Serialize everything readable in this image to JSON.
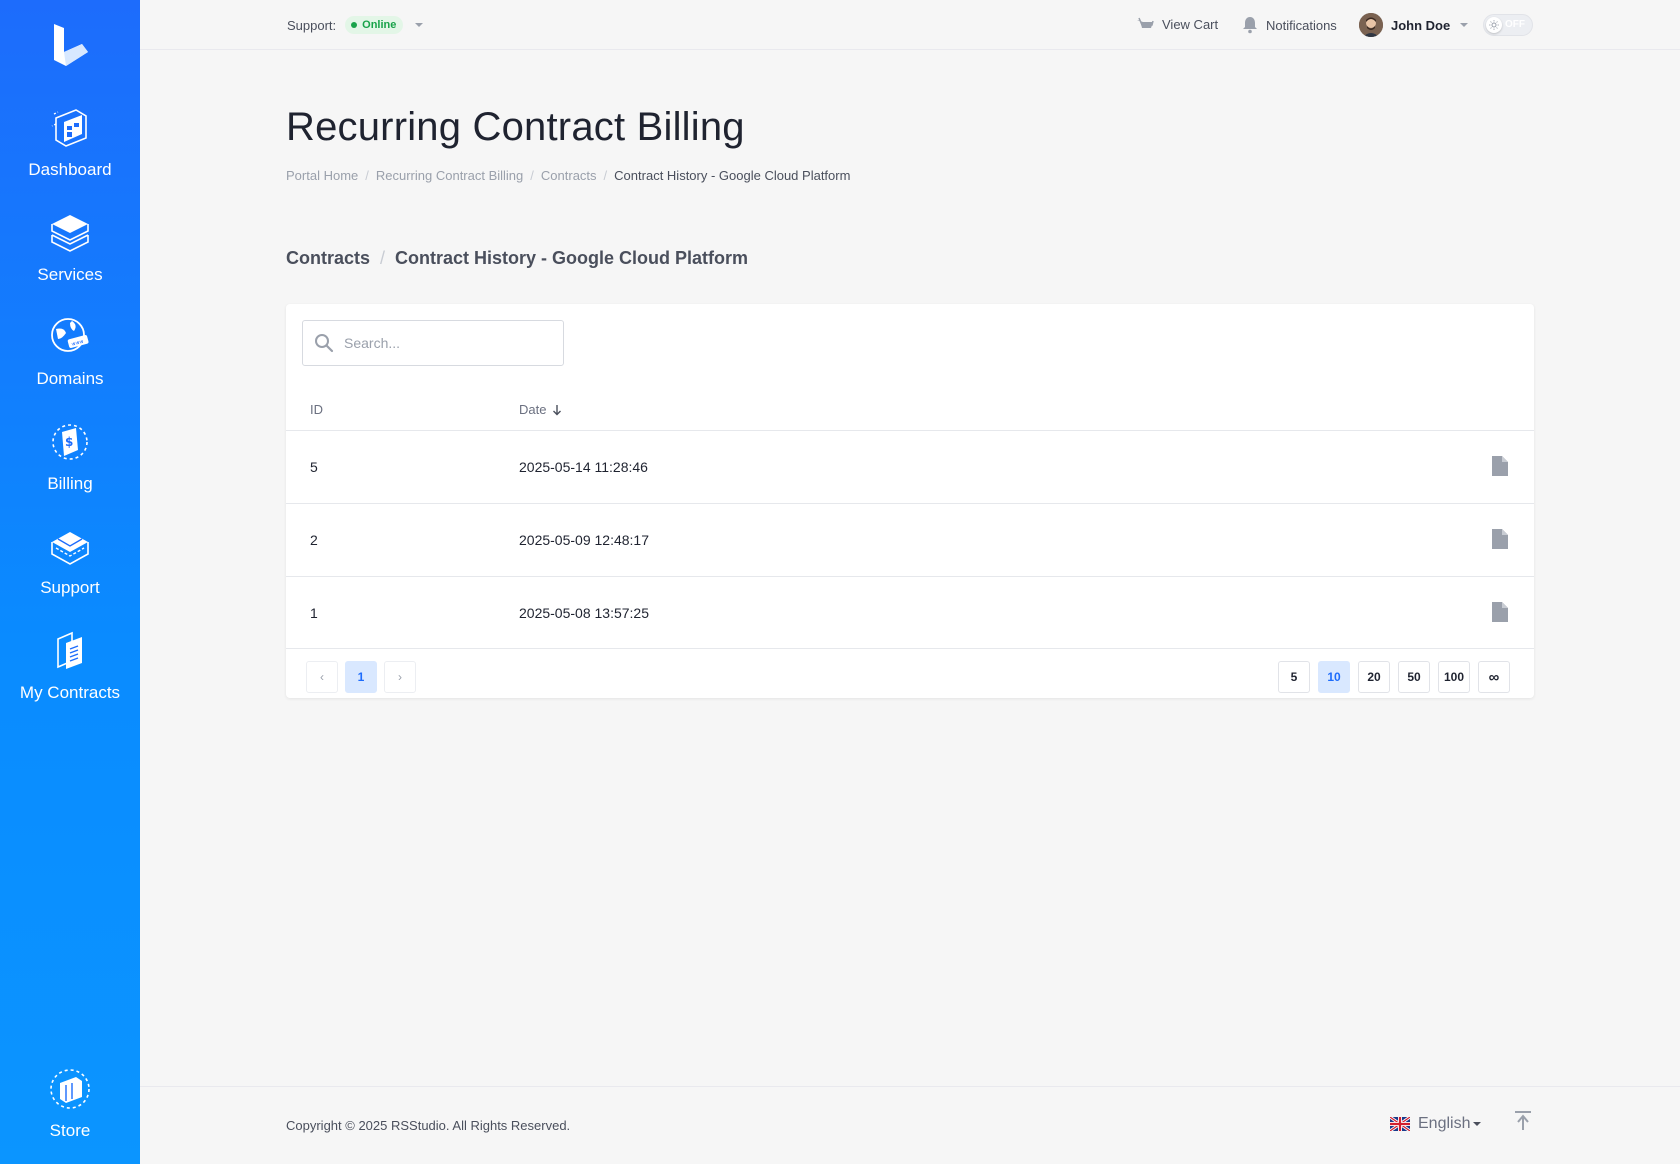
{
  "sidebar": {
    "items": [
      {
        "label": "Dashboard",
        "icon": "dashboard-icon"
      },
      {
        "label": "Services",
        "icon": "services-icon"
      },
      {
        "label": "Domains",
        "icon": "domains-icon"
      },
      {
        "label": "Billing",
        "icon": "billing-icon"
      },
      {
        "label": "Support",
        "icon": "support-icon"
      },
      {
        "label": "My Contracts",
        "icon": "contracts-icon"
      }
    ],
    "store": {
      "label": "Store",
      "icon": "store-icon"
    }
  },
  "topbar": {
    "support_label": "Support:",
    "support_status": "Online",
    "view_cart": "View Cart",
    "notifications": "Notifications",
    "user_name": "John Doe",
    "dark_mode_toggle": "OFF"
  },
  "page": {
    "title": "Recurring Contract Billing",
    "breadcrumb": [
      "Portal Home",
      "Recurring Contract Billing",
      "Contracts",
      "Contract History - Google Cloud Platform"
    ],
    "section": {
      "parent": "Contracts",
      "current": "Contract History - Google Cloud Platform"
    }
  },
  "table": {
    "search_placeholder": "Search...",
    "headers": {
      "id": "ID",
      "date": "Date"
    },
    "rows": [
      {
        "id": "5",
        "date": "2025-05-14 11:28:46"
      },
      {
        "id": "2",
        "date": "2025-05-09 12:48:17"
      },
      {
        "id": "1",
        "date": "2025-05-08 13:57:25"
      }
    ],
    "pagination": {
      "prev": "‹",
      "current": "1",
      "next": "›"
    },
    "page_sizes": [
      "5",
      "10",
      "20",
      "50",
      "100",
      "∞"
    ],
    "selected_page_size": "10"
  },
  "footer": {
    "copyright": "Copyright © 2025 RSStudio. All Rights Reserved.",
    "language": "English"
  },
  "colors": {
    "sidebar_top": "#1d6cfc",
    "sidebar_bottom": "#0b95ff",
    "online": "#19a34a",
    "accent": "#1d6cfc"
  }
}
